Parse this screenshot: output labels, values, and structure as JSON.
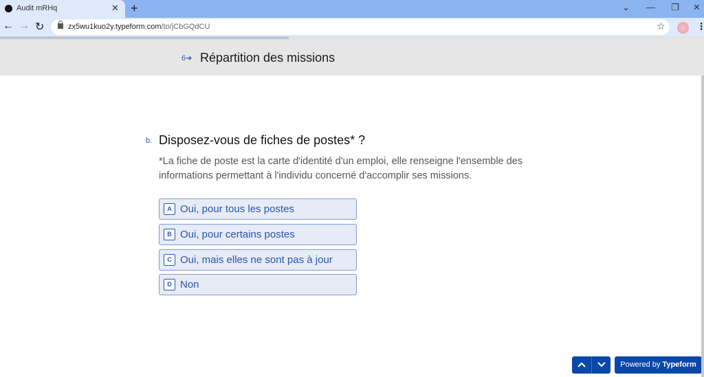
{
  "browser": {
    "tab_title": "Audit mRHq",
    "url_host": "zx5wu1kuo2y.typeform.com",
    "url_path": "/to/jCbGQdCU"
  },
  "progress": {
    "percent": 41
  },
  "section": {
    "number": "6",
    "title": "Répartition des missions"
  },
  "question": {
    "letter": "b.",
    "title": "Disposez-vous de fiches de postes* ?",
    "description": "*La fiche de poste est la carte d'identité d'un emploi, elle renseigne l'ensemble des informations permettant à l'individu concerné d'accomplir ses missions.",
    "choices": [
      {
        "key": "A",
        "label": "Oui, pour tous les postes"
      },
      {
        "key": "B",
        "label": "Oui, pour certains postes"
      },
      {
        "key": "C",
        "label": "Oui, mais elles ne sont pas à jour"
      },
      {
        "key": "D",
        "label": "Non"
      }
    ]
  },
  "footer": {
    "powered_prefix": "Powered by",
    "powered_brand": "Typeform"
  },
  "colors": {
    "accent": "#2a55b3",
    "button_bg": "#0b47a9",
    "choice_bg": "#e6ebf6",
    "section_bg": "#e6e6e6"
  }
}
